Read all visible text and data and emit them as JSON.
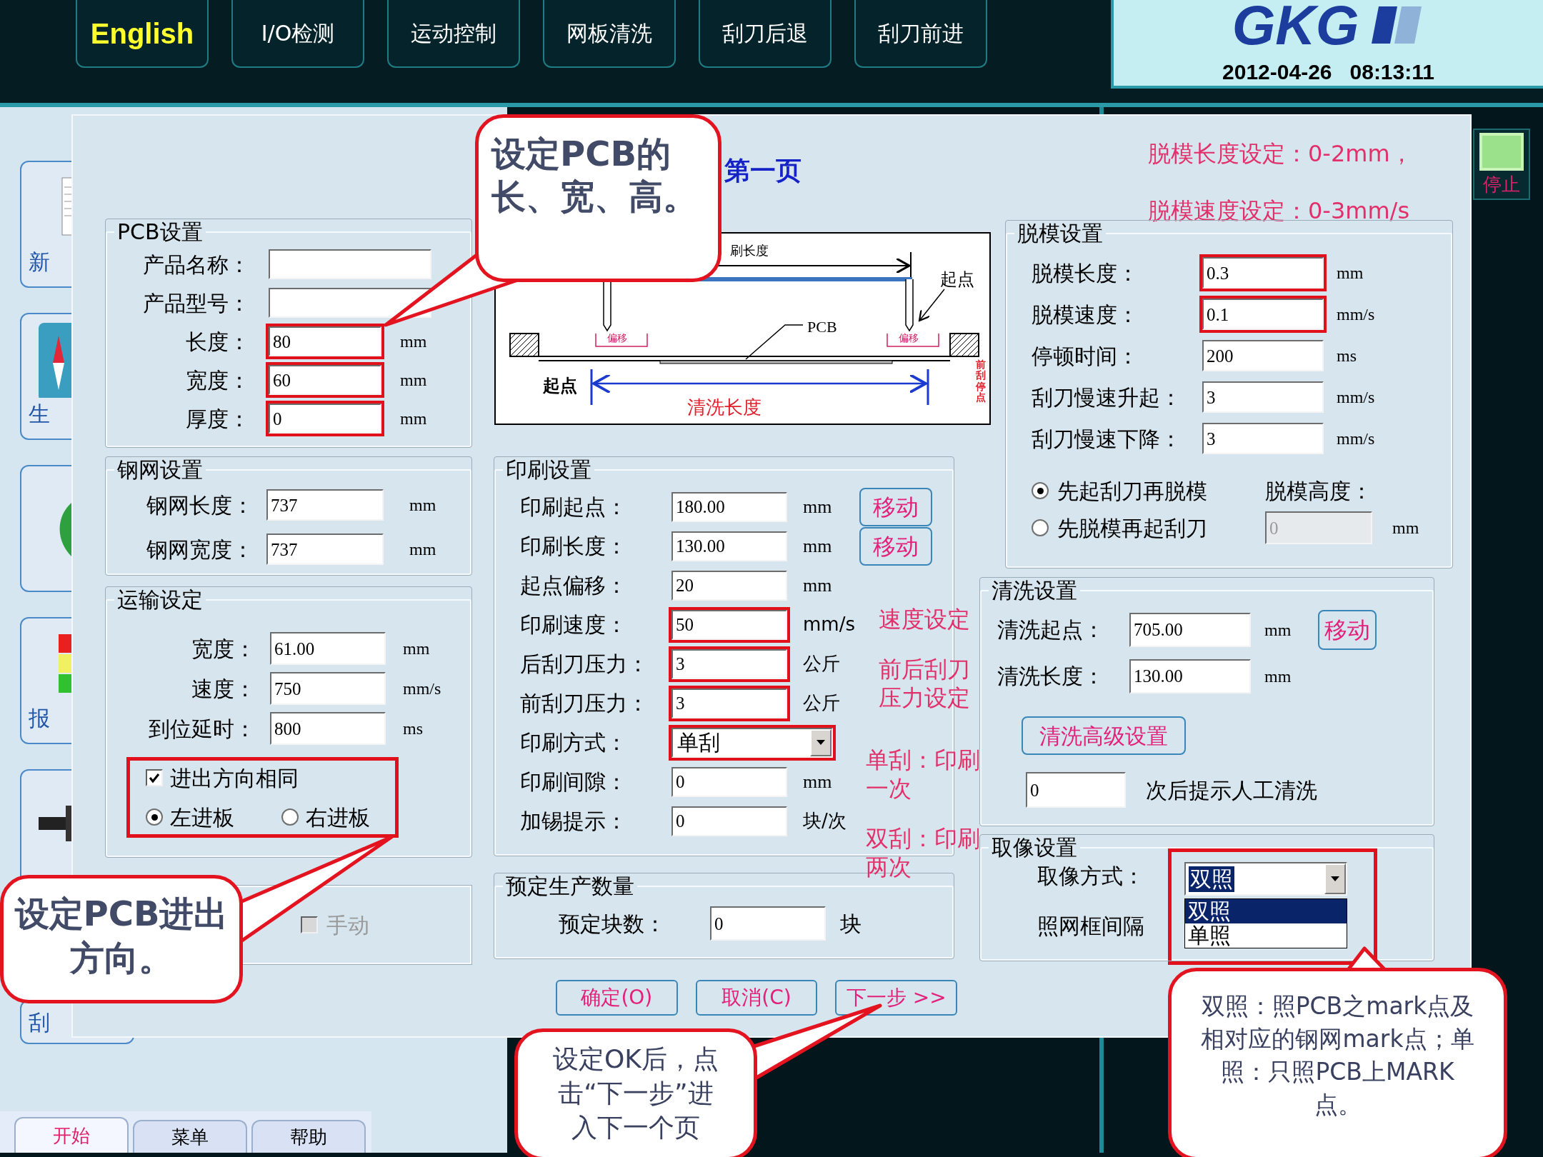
{
  "top_nav": [
    {
      "label": "English",
      "kind": "language"
    },
    {
      "label": "I/O检测",
      "kind": "function"
    },
    {
      "label": "运动控制",
      "kind": "function"
    },
    {
      "label": "网板清洗",
      "kind": "function"
    },
    {
      "label": "刮刀后退",
      "kind": "function"
    },
    {
      "label": "刮刀前进",
      "kind": "function"
    }
  ],
  "brand": {
    "logo": "GKG",
    "datetime": "2012-04-26   08:13:11"
  },
  "side_buttons": [
    {
      "label": "新",
      "kind": "document"
    },
    {
      "label": "生",
      "kind": "compass"
    },
    {
      "kind": "leaf"
    },
    {
      "label": "报",
      "kind": "signal"
    },
    {
      "kind": "tool"
    },
    {
      "label": "刮",
      "kind": "plain"
    }
  ],
  "bottom_tabs": [
    {
      "label": "开始",
      "selected": true
    },
    {
      "label": "菜单",
      "selected": false
    },
    {
      "label": "帮助",
      "selected": false
    }
  ],
  "stop_button": {
    "label": "停止"
  },
  "dialog": {
    "title": "第一页",
    "notes": [
      "脱模长度设定：0-2mm，",
      "脱模速度设定：0-3mm/s"
    ],
    "pcb_settings": {
      "title": "PCB设置",
      "rows": [
        {
          "label": "产品名称：",
          "highlighted": false
        },
        {
          "label": "产品型号：",
          "highlighted": false
        },
        {
          "label": "长度：",
          "value": "80",
          "unit": "mm",
          "highlighted": true
        },
        {
          "label": "宽度：",
          "value": "60",
          "unit": "mm",
          "highlighted": true
        },
        {
          "label": "厚度：",
          "value": "0",
          "unit": "mm",
          "highlighted": true
        }
      ]
    },
    "stencil_settings": {
      "title": "钢网设置",
      "rows": [
        {
          "label": "钢网长度：",
          "value": "737",
          "unit": "mm"
        },
        {
          "label": "钢网宽度：",
          "value": "737",
          "unit": "mm"
        }
      ]
    },
    "conveyor_settings": {
      "title": "运输设定",
      "rows": [
        {
          "label": "宽度：",
          "value": "61.00",
          "unit": "mm"
        },
        {
          "label": "速度：",
          "value": "750",
          "unit": "mm/s"
        },
        {
          "label": "到位延时：",
          "value": "800",
          "unit": "ms"
        }
      ],
      "direction": {
        "highlighted": true,
        "same_direction": {
          "label": "进出方向相同",
          "checked": true
        },
        "entry": [
          {
            "label": "左进板",
            "selected": true
          },
          {
            "label": "右进板",
            "selected": false
          }
        ]
      }
    },
    "manual": {
      "label": "手动",
      "checked": false,
      "disabled": true
    },
    "diagram": {
      "labels": [
        {
          "kind": "print_length",
          "text": "刷长度"
        },
        {
          "kind": "start_right",
          "text": "起点"
        },
        {
          "kind": "pcb",
          "text": "PCB"
        },
        {
          "kind": "offset_left",
          "text": "偏移"
        },
        {
          "kind": "offset_right",
          "text": "偏移"
        },
        {
          "kind": "start_left",
          "text": "起点"
        },
        {
          "kind": "clean_length",
          "text": "清洗长度"
        },
        {
          "kind": "stop_point",
          "text": "前刮停点"
        }
      ]
    },
    "print_settings": {
      "title": "印刷设置",
      "rows": [
        {
          "kind": "field",
          "label": "印刷起点：",
          "value": "180.00",
          "unit": "mm",
          "button": "移动",
          "highlighted": false
        },
        {
          "kind": "field",
          "label": "印刷长度：",
          "value": "130.00",
          "unit": "mm",
          "button": "移动",
          "highlighted": false
        },
        {
          "kind": "field",
          "label": "起点偏移：",
          "value": "20",
          "unit": "mm",
          "highlighted": false
        },
        {
          "kind": "field",
          "label": "印刷速度：",
          "value": "50",
          "unit": "mm/s",
          "highlighted": true
        },
        {
          "kind": "field",
          "label": "后刮刀压力：",
          "value": "3",
          "unit": "公斤",
          "highlighted": true
        },
        {
          "kind": "field",
          "label": "前刮刀压力：",
          "value": "3",
          "unit": "公斤",
          "highlighted": true
        },
        {
          "kind": "dropdown",
          "label": "印刷方式：",
          "value": "单刮",
          "highlighted": true
        },
        {
          "kind": "field",
          "label": "印刷间隙：",
          "value": "0",
          "unit": "mm",
          "highlighted": false
        },
        {
          "kind": "field",
          "label": "加锡提示：",
          "value": "0",
          "unit": "块/次",
          "highlighted": false
        }
      ]
    },
    "print_notes": [
      "速度设定",
      "前后刮刀压力设定",
      "单刮：印刷一次",
      "双刮：印刷两次"
    ],
    "planned_output": {
      "title": "预定生产数量",
      "label": "预定块数：",
      "value": "0",
      "unit": "块"
    },
    "demold_settings": {
      "title": "脱模设置",
      "rows": [
        {
          "label": "脱模长度：",
          "value": "0.3",
          "unit": "mm",
          "highlighted": true
        },
        {
          "label": "脱模速度：",
          "value": "0.1",
          "unit": "mm/s",
          "highlighted": true
        },
        {
          "label": "停顿时间：",
          "value": "200",
          "unit": "ms",
          "highlighted": false
        },
        {
          "label": "刮刀慢速升起：",
          "value": "3",
          "unit": "mm/s",
          "highlighted": false
        },
        {
          "label": "刮刀慢速下降：",
          "value": "3",
          "unit": "mm/s",
          "highlighted": false
        }
      ],
      "order": [
        {
          "label": "先起刮刀再脱模",
          "selected": true
        },
        {
          "label": "先脱模再起刮刀",
          "selected": false
        }
      ],
      "height": {
        "label": "脱模高度：",
        "value": "0",
        "unit": "mm",
        "disabled": true
      }
    },
    "cleaning_settings": {
      "title": "清洗设置",
      "rows": [
        {
          "label": "清洗起点：",
          "value": "705.00",
          "unit": "mm",
          "button": "移动"
        },
        {
          "label": "清洗长度：",
          "value": "130.00",
          "unit": "mm"
        }
      ],
      "advanced_button": "清洗高级设置",
      "prompt": {
        "value": "0",
        "text": "次后提示人工清洗"
      }
    },
    "capture_settings": {
      "title": "取像设置",
      "label": "取像方式：",
      "value": "双照",
      "highlighted": true,
      "expanded": true,
      "options": [
        {
          "label": "双照",
          "selected": true
        },
        {
          "label": "单照",
          "selected": false
        }
      ],
      "interval_label": "照网框间隔"
    },
    "buttons": [
      "确定(O)",
      "取消(C)",
      "下一步 >>"
    ]
  },
  "callouts": [
    "设定PCB的长、宽、高。",
    "设定PCB进出方向。",
    "设定OK后，点击“下一步”进入下一个页",
    "双照：照PCB之mark点及相对应的钢网mark点；单照：只照PCB上MARK点。"
  ]
}
